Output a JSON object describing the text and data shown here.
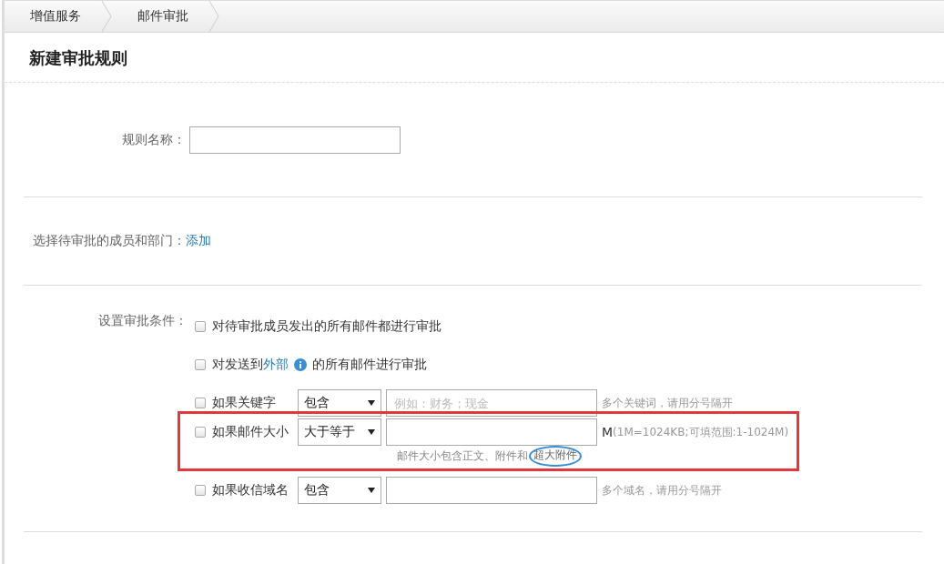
{
  "breadcrumb": [
    {
      "label": "增值服务"
    },
    {
      "label": "邮件审批"
    }
  ],
  "title": "新建审批规则",
  "rule_name": {
    "label": "规则名称："
  },
  "members": {
    "label": "选择待审批的成员和部门：",
    "link": "添加"
  },
  "conditions": {
    "label": "设置审批条件：",
    "items": [
      {
        "kind": "plain",
        "checked": false,
        "text": "对待审批成员发出的所有邮件都进行审批"
      },
      {
        "kind": "link",
        "checked": false,
        "before": "对发送到",
        "link": "外部",
        "after": "的所有邮件进行审批"
      },
      {
        "kind": "select",
        "checked": false,
        "text": "如果关键字",
        "select": "包含",
        "placeholder": "例如：财务；现金",
        "note": "多个关键词，请用分号隔开",
        "highlighted": false
      },
      {
        "kind": "select",
        "checked": false,
        "text": "如果邮件大小",
        "select": "大于等于",
        "unit": "M",
        "note": "(1M=1024KB;可填范围:1-1024M)",
        "hint": "邮件大小包含正文、附件和",
        "hint_circled": "超大附件",
        "highlighted": true
      },
      {
        "kind": "select",
        "checked": false,
        "text": "如果收信域名",
        "select": "包含",
        "note": "多个域名，请用分号隔开",
        "highlighted": false
      }
    ]
  }
}
